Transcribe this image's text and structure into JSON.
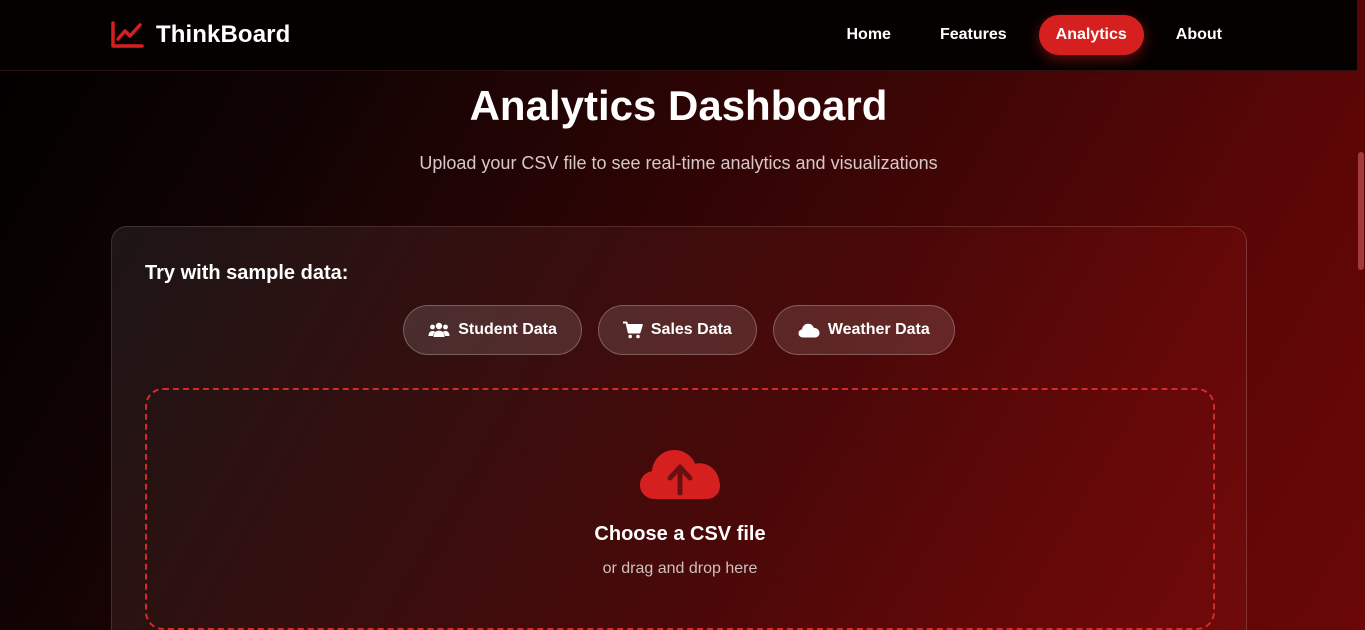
{
  "nav": {
    "brand": "ThinkBoard",
    "links": [
      {
        "label": "Home",
        "active": false
      },
      {
        "label": "Features",
        "active": false
      },
      {
        "label": "Analytics",
        "active": true
      },
      {
        "label": "About",
        "active": false
      }
    ]
  },
  "hero": {
    "title": "Analytics Dashboard",
    "subtitle": "Upload your CSV file to see real-time analytics and visualizations"
  },
  "samples": {
    "heading": "Try with sample data:",
    "buttons": [
      {
        "label": "Student Data",
        "icon": "users-icon"
      },
      {
        "label": "Sales Data",
        "icon": "shopping-cart-icon"
      },
      {
        "label": "Weather Data",
        "icon": "cloud-icon"
      }
    ]
  },
  "upload": {
    "title": "Choose a CSV file",
    "subtitle": "or drag and drop here",
    "icon": "cloud-upload-icon"
  },
  "colors": {
    "accent": "#d62020",
    "background_dark": "#000000",
    "background_red": "#6a0707"
  }
}
